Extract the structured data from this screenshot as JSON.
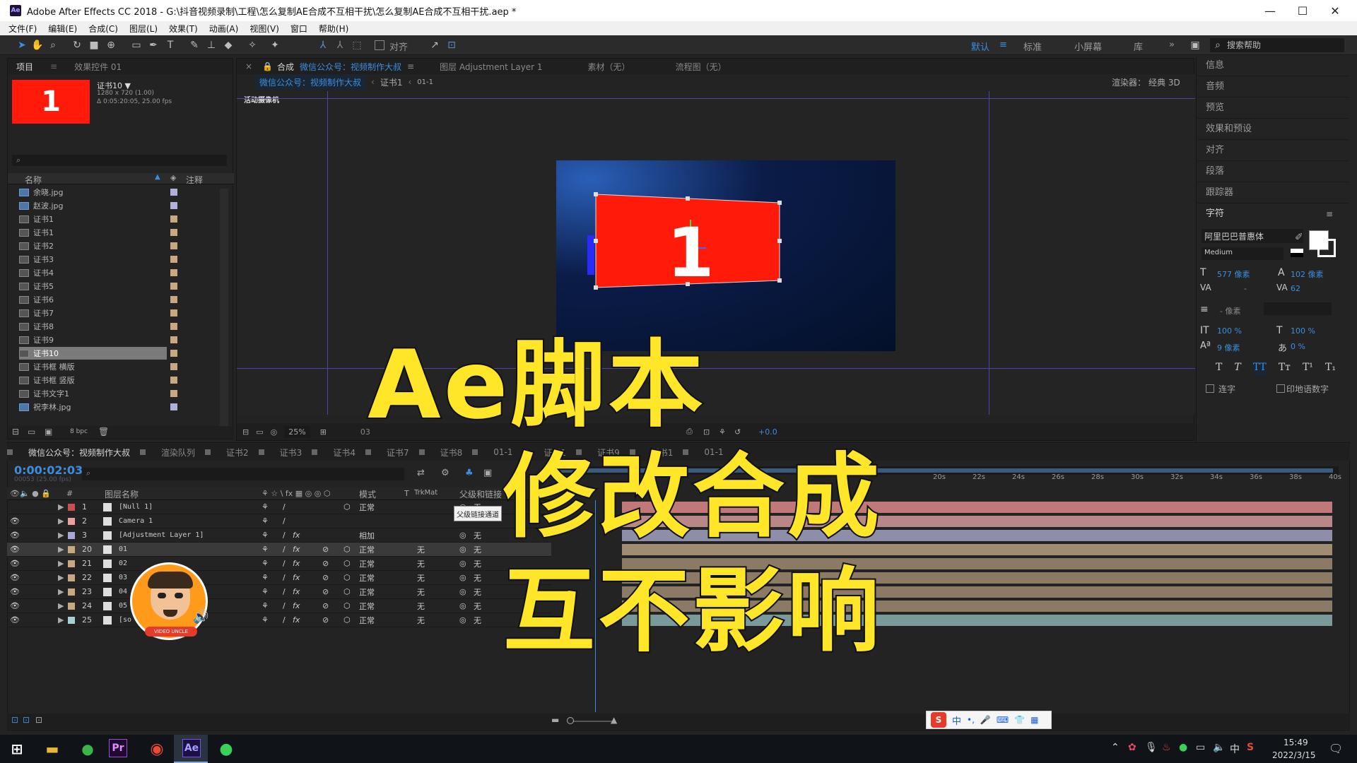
{
  "app": {
    "window_title": "Adobe After Effects CC 2018 - G:\\抖音视频录制\\工程\\怎么复制AE合成不互相干扰\\怎么复制AE合成不互相干扰.aep *",
    "logo_text": "Ae"
  },
  "window_controls": {
    "minimize": "—",
    "maximize": "☐",
    "close": "✕"
  },
  "menu": [
    "文件(F)",
    "编辑(E)",
    "合成(C)",
    "图层(L)",
    "效果(T)",
    "动画(A)",
    "视图(V)",
    "窗口",
    "帮助(H)"
  ],
  "toolbar": {
    "align_label": "对齐",
    "workspaces": [
      "默认",
      "标准",
      "小屏幕",
      "库"
    ],
    "active_workspace": "默认",
    "help_placeholder": "搜索帮助",
    "more": "»"
  },
  "project_panel": {
    "tabs": [
      "项目",
      "效果控件 01"
    ],
    "thumb_number": "1",
    "comp_name": "证书10 ▼",
    "comp_info_1": "1280 x 720 (1.00)",
    "comp_info_2": "Δ 0:05:20:05, 25.00 fps",
    "col_name": "名称",
    "col_comment": "注释",
    "items": [
      {
        "name": "余晓.jpg",
        "type": "img",
        "color": "#b0b0d8"
      },
      {
        "name": "赵波.jpg",
        "type": "img",
        "color": "#b0b0d8"
      },
      {
        "name": "证书1",
        "type": "comp",
        "color": "#c8a880"
      },
      {
        "name": "证书1",
        "type": "comp",
        "color": "#c8a880"
      },
      {
        "name": "证书2",
        "type": "comp",
        "color": "#c8a880"
      },
      {
        "name": "证书3",
        "type": "comp",
        "color": "#c8a880"
      },
      {
        "name": "证书4",
        "type": "comp",
        "color": "#c8a880"
      },
      {
        "name": "证书5",
        "type": "comp",
        "color": "#c8a880"
      },
      {
        "name": "证书6",
        "type": "comp",
        "color": "#c8a880"
      },
      {
        "name": "证书7",
        "type": "comp",
        "color": "#c8a880"
      },
      {
        "name": "证书8",
        "type": "comp",
        "color": "#c8a880"
      },
      {
        "name": "证书9",
        "type": "comp",
        "color": "#c8a880"
      },
      {
        "name": "证书10",
        "type": "comp",
        "color": "#c8a880",
        "selected": true
      },
      {
        "name": "证书框 横版",
        "type": "comp",
        "color": "#c8a880"
      },
      {
        "name": "证书框 竖版",
        "type": "comp",
        "color": "#c8a880"
      },
      {
        "name": "证书文字1",
        "type": "comp",
        "color": "#c8a880"
      },
      {
        "name": "祝李林.jpg",
        "type": "img",
        "color": "#b0b0d8"
      }
    ],
    "bpc": "8 bpc"
  },
  "comp_panel": {
    "tab_prefix": "合成",
    "tab_comp_name": "微信公众号：视频制作大叔",
    "layer_tab": "图层 Adjustment Layer 1",
    "footage_tab": "素材（无）",
    "flow_tab": "流程图（无）",
    "breadcrumb": [
      "微信公众号：视频制作大叔",
      "证书1",
      "01-1"
    ],
    "renderer_label": "渲染器：",
    "renderer_value": "经典 3D",
    "camera_label": "活动摄像机",
    "card_number": "1",
    "zoom": "25%",
    "exposure": "+0.0",
    "resolution_snippet": "03"
  },
  "right_panel": {
    "items": [
      "信息",
      "音频",
      "预览",
      "效果和预设",
      "对齐",
      "段落",
      "跟踪器"
    ],
    "char_title": "字符",
    "font_family": "阿里巴巴普惠体",
    "font_style": "Medium",
    "font_size": "577 像素",
    "leading": "102 像素",
    "tracking": "62",
    "kerning": "-",
    "stroke": "- 像素",
    "vert_scale": "100 %",
    "horiz_scale": "100 %",
    "baseline": "9 像素",
    "tsume": "0 %",
    "ligature": "连字",
    "hindi_digits": "印地语数字"
  },
  "timeline": {
    "tabs": [
      "微信公众号：视频制作大叔",
      "渲染队列",
      "证书2",
      "证书3",
      "证书4",
      "证书7",
      "证书8",
      "01-1",
      "证书1",
      "证书9",
      "证书1",
      "01-1"
    ],
    "timecode": "0:00:02:03",
    "frames": "00053 (25.00 fps)",
    "col_layer_name": "图层名称",
    "col_mode": "模式",
    "col_t": "T",
    "col_trkmat": "TrkMat",
    "col_parent": "父级和链接",
    "tooltip": "父级链接通道及链接",
    "ruler": [
      "20s",
      "22s",
      "24s",
      "26s",
      "28s",
      "30s",
      "32s",
      "34s",
      "36s",
      "38s",
      "40s"
    ],
    "layers": [
      {
        "num": "1",
        "name": "[Null 1]",
        "mode": "正常",
        "trkmat": "",
        "parent": "无",
        "color": "#c85050",
        "bar": "#c07878"
      },
      {
        "num": "2",
        "name": "Camera 1",
        "mode": "",
        "trkmat": "",
        "parent": "",
        "color": "#e8a0a0",
        "bar": "#b88888"
      },
      {
        "num": "3",
        "name": "[Adjustment Layer 1]",
        "mode": "相加",
        "trkmat": "",
        "parent": "无",
        "color": "#a8a8d8",
        "bar": "#8e8ea8"
      },
      {
        "num": "20",
        "name": "01",
        "mode": "正常",
        "trkmat": "无",
        "parent": "无",
        "color": "#c8a880",
        "bar": "#a08c70",
        "selected": true
      },
      {
        "num": "21",
        "name": "02",
        "mode": "正常",
        "trkmat": "无",
        "parent": "无",
        "color": "#c8a880",
        "bar": "#8a7a66"
      },
      {
        "num": "22",
        "name": "03",
        "mode": "正常",
        "trkmat": "无",
        "parent": "无",
        "color": "#c8a880",
        "bar": "#8a7a66"
      },
      {
        "num": "23",
        "name": "04",
        "mode": "正常",
        "trkmat": "无",
        "parent": "无",
        "color": "#c8a880",
        "bar": "#8a7a66"
      },
      {
        "num": "24",
        "name": "05",
        "mode": "正常",
        "trkmat": "无",
        "parent": "无",
        "color": "#c8a880",
        "bar": "#8a7a66"
      },
      {
        "num": "25",
        "name": "[so",
        "mode": "正常",
        "trkmat": "无",
        "parent": "无",
        "color": "#a8d0d0",
        "bar": "#7a9a9a"
      }
    ]
  },
  "overlay": {
    "line1": "Ae脚本",
    "line2": "修改合成",
    "line3": "互不影响",
    "avatar_badge": "VIDEO UNCLE"
  },
  "ime_bar": {
    "items": [
      "中",
      "•,",
      "🎤",
      "⌨",
      "👕",
      "▦"
    ]
  },
  "taskbar": {
    "apps": [
      "Pr",
      "Ae"
    ],
    "time": "15:49",
    "date": "2022/3/15",
    "ime": "中"
  },
  "colors": {
    "accent_blue": "#3b8ede",
    "card_red": "#ff1a0a",
    "overlay_yellow": "#ffe628",
    "timecode_blue": "#3b8ede"
  }
}
